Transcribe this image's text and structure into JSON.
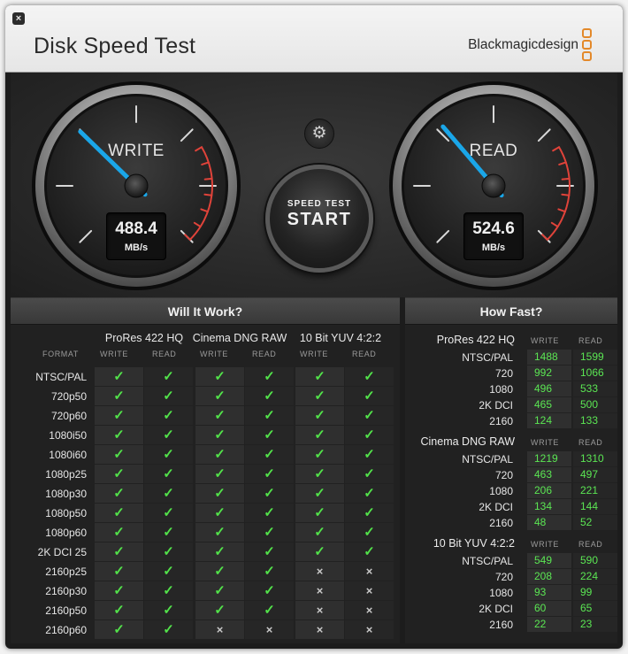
{
  "window": {
    "title": "Disk Speed Test",
    "close_glyph": "×",
    "brand": "Blackmagicdesign",
    "accent_color": "#e3892a"
  },
  "gauges": {
    "write": {
      "label": "WRITE",
      "value": "488.4",
      "unit": "MB/s",
      "needle_fraction": 0.33
    },
    "read": {
      "label": "READ",
      "value": "524.6",
      "unit": "MB/s",
      "needle_fraction": 0.35
    },
    "needle_color": "#1aa6e8",
    "redline_color": "#e0433a"
  },
  "controls": {
    "settings_icon": "gear-icon",
    "start_small": "SPEED TEST",
    "start_big": "START"
  },
  "will_it_work": {
    "title": "Will It Work?",
    "format_header": "FORMAT",
    "write_header": "WRITE",
    "read_header": "READ",
    "codecs": [
      "ProRes 422 HQ",
      "Cinema DNG RAW",
      "10 Bit YUV 4:2:2"
    ],
    "rows": [
      {
        "format": "NTSC/PAL",
        "results": [
          true,
          true,
          true,
          true,
          true,
          true
        ]
      },
      {
        "format": "720p50",
        "results": [
          true,
          true,
          true,
          true,
          true,
          true
        ]
      },
      {
        "format": "720p60",
        "results": [
          true,
          true,
          true,
          true,
          true,
          true
        ]
      },
      {
        "format": "1080i50",
        "results": [
          true,
          true,
          true,
          true,
          true,
          true
        ]
      },
      {
        "format": "1080i60",
        "results": [
          true,
          true,
          true,
          true,
          true,
          true
        ]
      },
      {
        "format": "1080p25",
        "results": [
          true,
          true,
          true,
          true,
          true,
          true
        ]
      },
      {
        "format": "1080p30",
        "results": [
          true,
          true,
          true,
          true,
          true,
          true
        ]
      },
      {
        "format": "1080p50",
        "results": [
          true,
          true,
          true,
          true,
          true,
          true
        ]
      },
      {
        "format": "1080p60",
        "results": [
          true,
          true,
          true,
          true,
          true,
          true
        ]
      },
      {
        "format": "2K DCI 25",
        "results": [
          true,
          true,
          true,
          true,
          true,
          true
        ]
      },
      {
        "format": "2160p25",
        "results": [
          true,
          true,
          true,
          true,
          false,
          false
        ]
      },
      {
        "format": "2160p30",
        "results": [
          true,
          true,
          true,
          true,
          false,
          false
        ]
      },
      {
        "format": "2160p50",
        "results": [
          true,
          true,
          true,
          true,
          false,
          false
        ]
      },
      {
        "format": "2160p60",
        "results": [
          true,
          true,
          false,
          false,
          false,
          false
        ]
      }
    ],
    "check_glyph": "✓",
    "cross_glyph": "×"
  },
  "how_fast": {
    "title": "How Fast?",
    "write_header": "WRITE",
    "read_header": "READ",
    "sections": [
      {
        "codec": "ProRes 422 HQ",
        "rows": [
          {
            "format": "NTSC/PAL",
            "write": "1488",
            "read": "1599"
          },
          {
            "format": "720",
            "write": "992",
            "read": "1066"
          },
          {
            "format": "1080",
            "write": "496",
            "read": "533"
          },
          {
            "format": "2K DCI",
            "write": "465",
            "read": "500"
          },
          {
            "format": "2160",
            "write": "124",
            "read": "133"
          }
        ]
      },
      {
        "codec": "Cinema DNG RAW",
        "rows": [
          {
            "format": "NTSC/PAL",
            "write": "1219",
            "read": "1310"
          },
          {
            "format": "720",
            "write": "463",
            "read": "497"
          },
          {
            "format": "1080",
            "write": "206",
            "read": "221"
          },
          {
            "format": "2K DCI",
            "write": "134",
            "read": "144"
          },
          {
            "format": "2160",
            "write": "48",
            "read": "52"
          }
        ]
      },
      {
        "codec": "10 Bit YUV 4:2:2",
        "rows": [
          {
            "format": "NTSC/PAL",
            "write": "549",
            "read": "590"
          },
          {
            "format": "720",
            "write": "208",
            "read": "224"
          },
          {
            "format": "1080",
            "write": "93",
            "read": "99"
          },
          {
            "format": "2K DCI",
            "write": "60",
            "read": "65"
          },
          {
            "format": "2160",
            "write": "22",
            "read": "23"
          }
        ]
      }
    ]
  }
}
